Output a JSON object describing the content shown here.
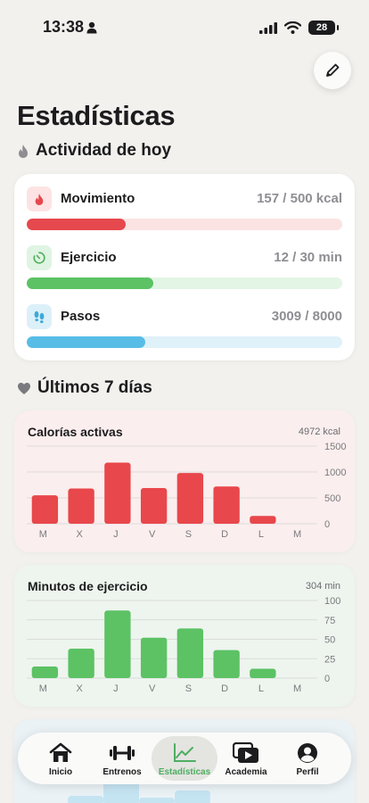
{
  "status_bar": {
    "time": "13:38",
    "battery": "28"
  },
  "page": {
    "title": "Estadísticas"
  },
  "today": {
    "header": "Actividad de hoy",
    "metrics": [
      {
        "label": "Movimiento",
        "value": "157 / 500 kcal",
        "progress": 0.314,
        "color": "#e5484d",
        "track": "#fbe3e3",
        "icon": "flame-icon",
        "icon_bg": "#fde3e3"
      },
      {
        "label": "Ejercicio",
        "value": "12 / 30 min",
        "progress": 0.4,
        "color": "#5cc264",
        "track": "#e3f5e5",
        "icon": "timer-icon",
        "icon_bg": "#e0f4e3"
      },
      {
        "label": "Pasos",
        "value": "3009 / 8000",
        "progress": 0.376,
        "color": "#58bde6",
        "track": "#dff1f9",
        "icon": "footsteps-icon",
        "icon_bg": "#dcf0f9"
      }
    ]
  },
  "last7": {
    "header": "Últimos 7 días"
  },
  "chart_data": [
    {
      "type": "bar",
      "title": "Calorías activas",
      "total": "4972 kcal",
      "categories": [
        "M",
        "X",
        "J",
        "V",
        "S",
        "D",
        "L",
        "M"
      ],
      "values": [
        550,
        680,
        1180,
        690,
        980,
        720,
        150,
        0
      ],
      "yticks": [
        "1500",
        "1000",
        "500",
        "0"
      ],
      "ylim": [
        0,
        1500
      ],
      "color": "#e8474b"
    },
    {
      "type": "bar",
      "title": "Minutos de ejercicio",
      "total": "304 min",
      "categories": [
        "M",
        "X",
        "J",
        "V",
        "S",
        "D",
        "L",
        "M"
      ],
      "values": [
        15,
        38,
        87,
        52,
        64,
        36,
        12,
        0
      ],
      "yticks": [
        "100",
        "75",
        "50",
        "25",
        "0"
      ],
      "ylim": [
        0,
        100
      ],
      "color": "#5cc264"
    }
  ],
  "tabs": [
    {
      "label": "Inicio",
      "icon": "home-icon",
      "active": false
    },
    {
      "label": "Entrenos",
      "icon": "dumbbell-icon",
      "active": false
    },
    {
      "label": "Estadísticas",
      "icon": "chart-icon",
      "active": true
    },
    {
      "label": "Academia",
      "icon": "video-library-icon",
      "active": false
    },
    {
      "label": "Perfil",
      "icon": "profile-icon",
      "active": false
    }
  ]
}
